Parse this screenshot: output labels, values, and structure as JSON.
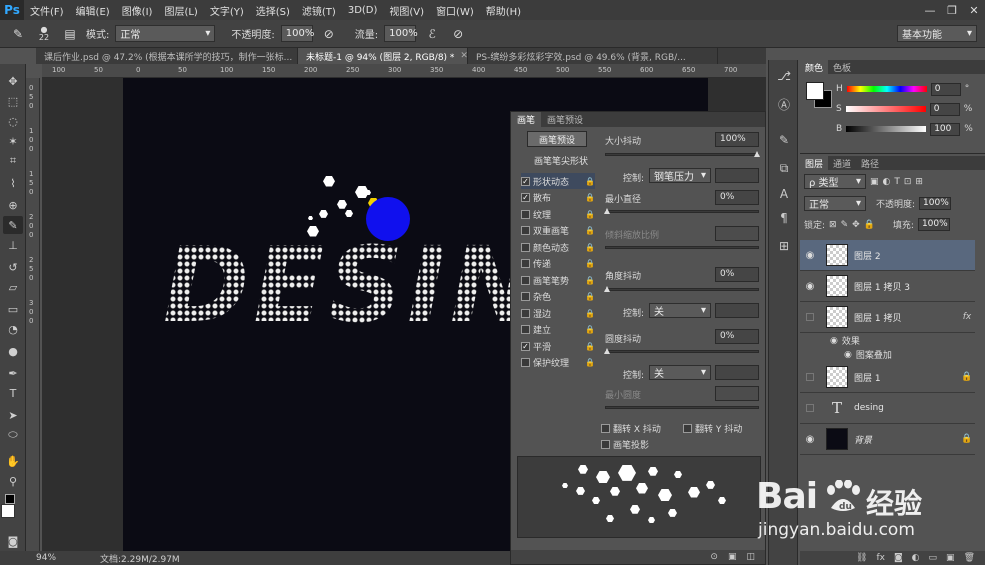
{
  "app": {
    "logo": "Ps"
  },
  "menu": [
    "文件(F)",
    "编辑(E)",
    "图像(I)",
    "图层(L)",
    "文字(Y)",
    "选择(S)",
    "滤镜(T)",
    "3D(D)",
    "视图(V)",
    "窗口(W)",
    "帮助(H)"
  ],
  "window_controls": [
    "—",
    "❐",
    "✕"
  ],
  "options": {
    "brush_size": "22",
    "mode_label": "模式:",
    "mode_value": "正常",
    "opacity_label": "不透明度:",
    "opacity_value": "100%",
    "flow_label": "流量:",
    "flow_value": "100%",
    "workspace": "基本功能"
  },
  "tabs": [
    {
      "label": "课后作业.psd @ 47.2% (根据本课所学的技巧，制作一张标...",
      "active": false
    },
    {
      "label": "未标题-1 @ 94% (图层 2, RGB/8) *",
      "active": true
    },
    {
      "label": "PS-缤纷多彩炫彩字效.psd @ 49.6% (背景, RGB/...",
      "active": false
    }
  ],
  "ruler_h": [
    "100",
    "50",
    "0",
    "50",
    "100",
    "150",
    "200",
    "250",
    "300",
    "350",
    "400",
    "450",
    "500",
    "550",
    "600",
    "650",
    "700"
  ],
  "ruler_v": [
    "0",
    "5",
    "0",
    "1",
    "0",
    "0",
    "1",
    "5",
    "0",
    "2",
    "0",
    "0",
    "2",
    "5",
    "0",
    "3",
    "0",
    "0"
  ],
  "canvas": {
    "text": "DESIN"
  },
  "status": {
    "zoom": "94%",
    "doc": "文档:2.29M/2.97M"
  },
  "brush_panel": {
    "tabs": [
      "画笔",
      "画笔预设"
    ],
    "presets_button": "画笔预设",
    "tip_heading": "画笔笔尖形状",
    "options": [
      {
        "label": "形状动态",
        "checked": true,
        "selected": true
      },
      {
        "label": "散布",
        "checked": true,
        "selected": false
      },
      {
        "label": "纹理",
        "checked": false,
        "selected": false
      },
      {
        "label": "双重画笔",
        "checked": false,
        "selected": false
      },
      {
        "label": "颜色动态",
        "checked": false,
        "selected": false
      },
      {
        "label": "传递",
        "checked": false,
        "selected": false
      },
      {
        "label": "画笔笔势",
        "checked": false,
        "selected": false
      },
      {
        "label": "杂色",
        "checked": false,
        "selected": false
      },
      {
        "label": "湿边",
        "checked": false,
        "selected": false
      },
      {
        "label": "建立",
        "checked": false,
        "selected": false
      },
      {
        "label": "平滑",
        "checked": true,
        "selected": false
      },
      {
        "label": "保护纹理",
        "checked": false,
        "selected": false
      }
    ],
    "size_jitter_label": "大小抖动",
    "size_jitter_value": "100%",
    "control_label": "控制:",
    "control_pen": "钢笔压力",
    "min_diameter_label": "最小直径",
    "min_diameter_value": "0%",
    "tilt_scale_label": "倾斜缩放比例",
    "angle_jitter_label": "角度抖动",
    "angle_jitter_value": "0%",
    "control_off": "关",
    "roundness_jitter_label": "圆度抖动",
    "roundness_jitter_value": "0%",
    "min_roundness_label": "最小圆度",
    "flip_x": "翻转 X 抖动",
    "flip_y": "翻转 Y 抖动",
    "brush_projection": "画笔投影"
  },
  "color_panel": {
    "tabs": [
      "颜色",
      "色板"
    ],
    "rows": [
      {
        "channel": "H",
        "value": "0",
        "unit": "°"
      },
      {
        "channel": "S",
        "value": "0",
        "unit": "%"
      },
      {
        "channel": "B",
        "value": "100",
        "unit": "%"
      }
    ]
  },
  "layers_panel": {
    "tabs": [
      "图层",
      "通道",
      "路径"
    ],
    "filter_kind": "ρ 类型",
    "blend_mode": "正常",
    "opacity_label": "不透明度:",
    "opacity_value": "100%",
    "lock_label": "锁定:",
    "fill_label": "填充:",
    "fill_value": "100%",
    "layers": [
      {
        "name": "图层 2",
        "visible": true,
        "selected": true
      },
      {
        "name": "图层 1 拷贝 3",
        "visible": true,
        "selected": false
      },
      {
        "name": "图层 1 拷贝",
        "visible": false,
        "selected": false,
        "badge": "fx"
      },
      {
        "name": "图层 1",
        "visible": false,
        "selected": false
      },
      {
        "name": "desing",
        "visible": false,
        "selected": false,
        "type": "text"
      },
      {
        "name": "背景",
        "visible": true,
        "selected": false,
        "type": "background"
      }
    ],
    "effects_label": "效果",
    "effect_item": "图案叠加"
  },
  "watermark": {
    "logo": "Bai",
    "product": "经验",
    "url": "jingyan.baidu.com"
  },
  "colors": {
    "brush_circle": "#1010ee",
    "selected_layer": "#59687e",
    "canvas": "#0b0b14"
  }
}
